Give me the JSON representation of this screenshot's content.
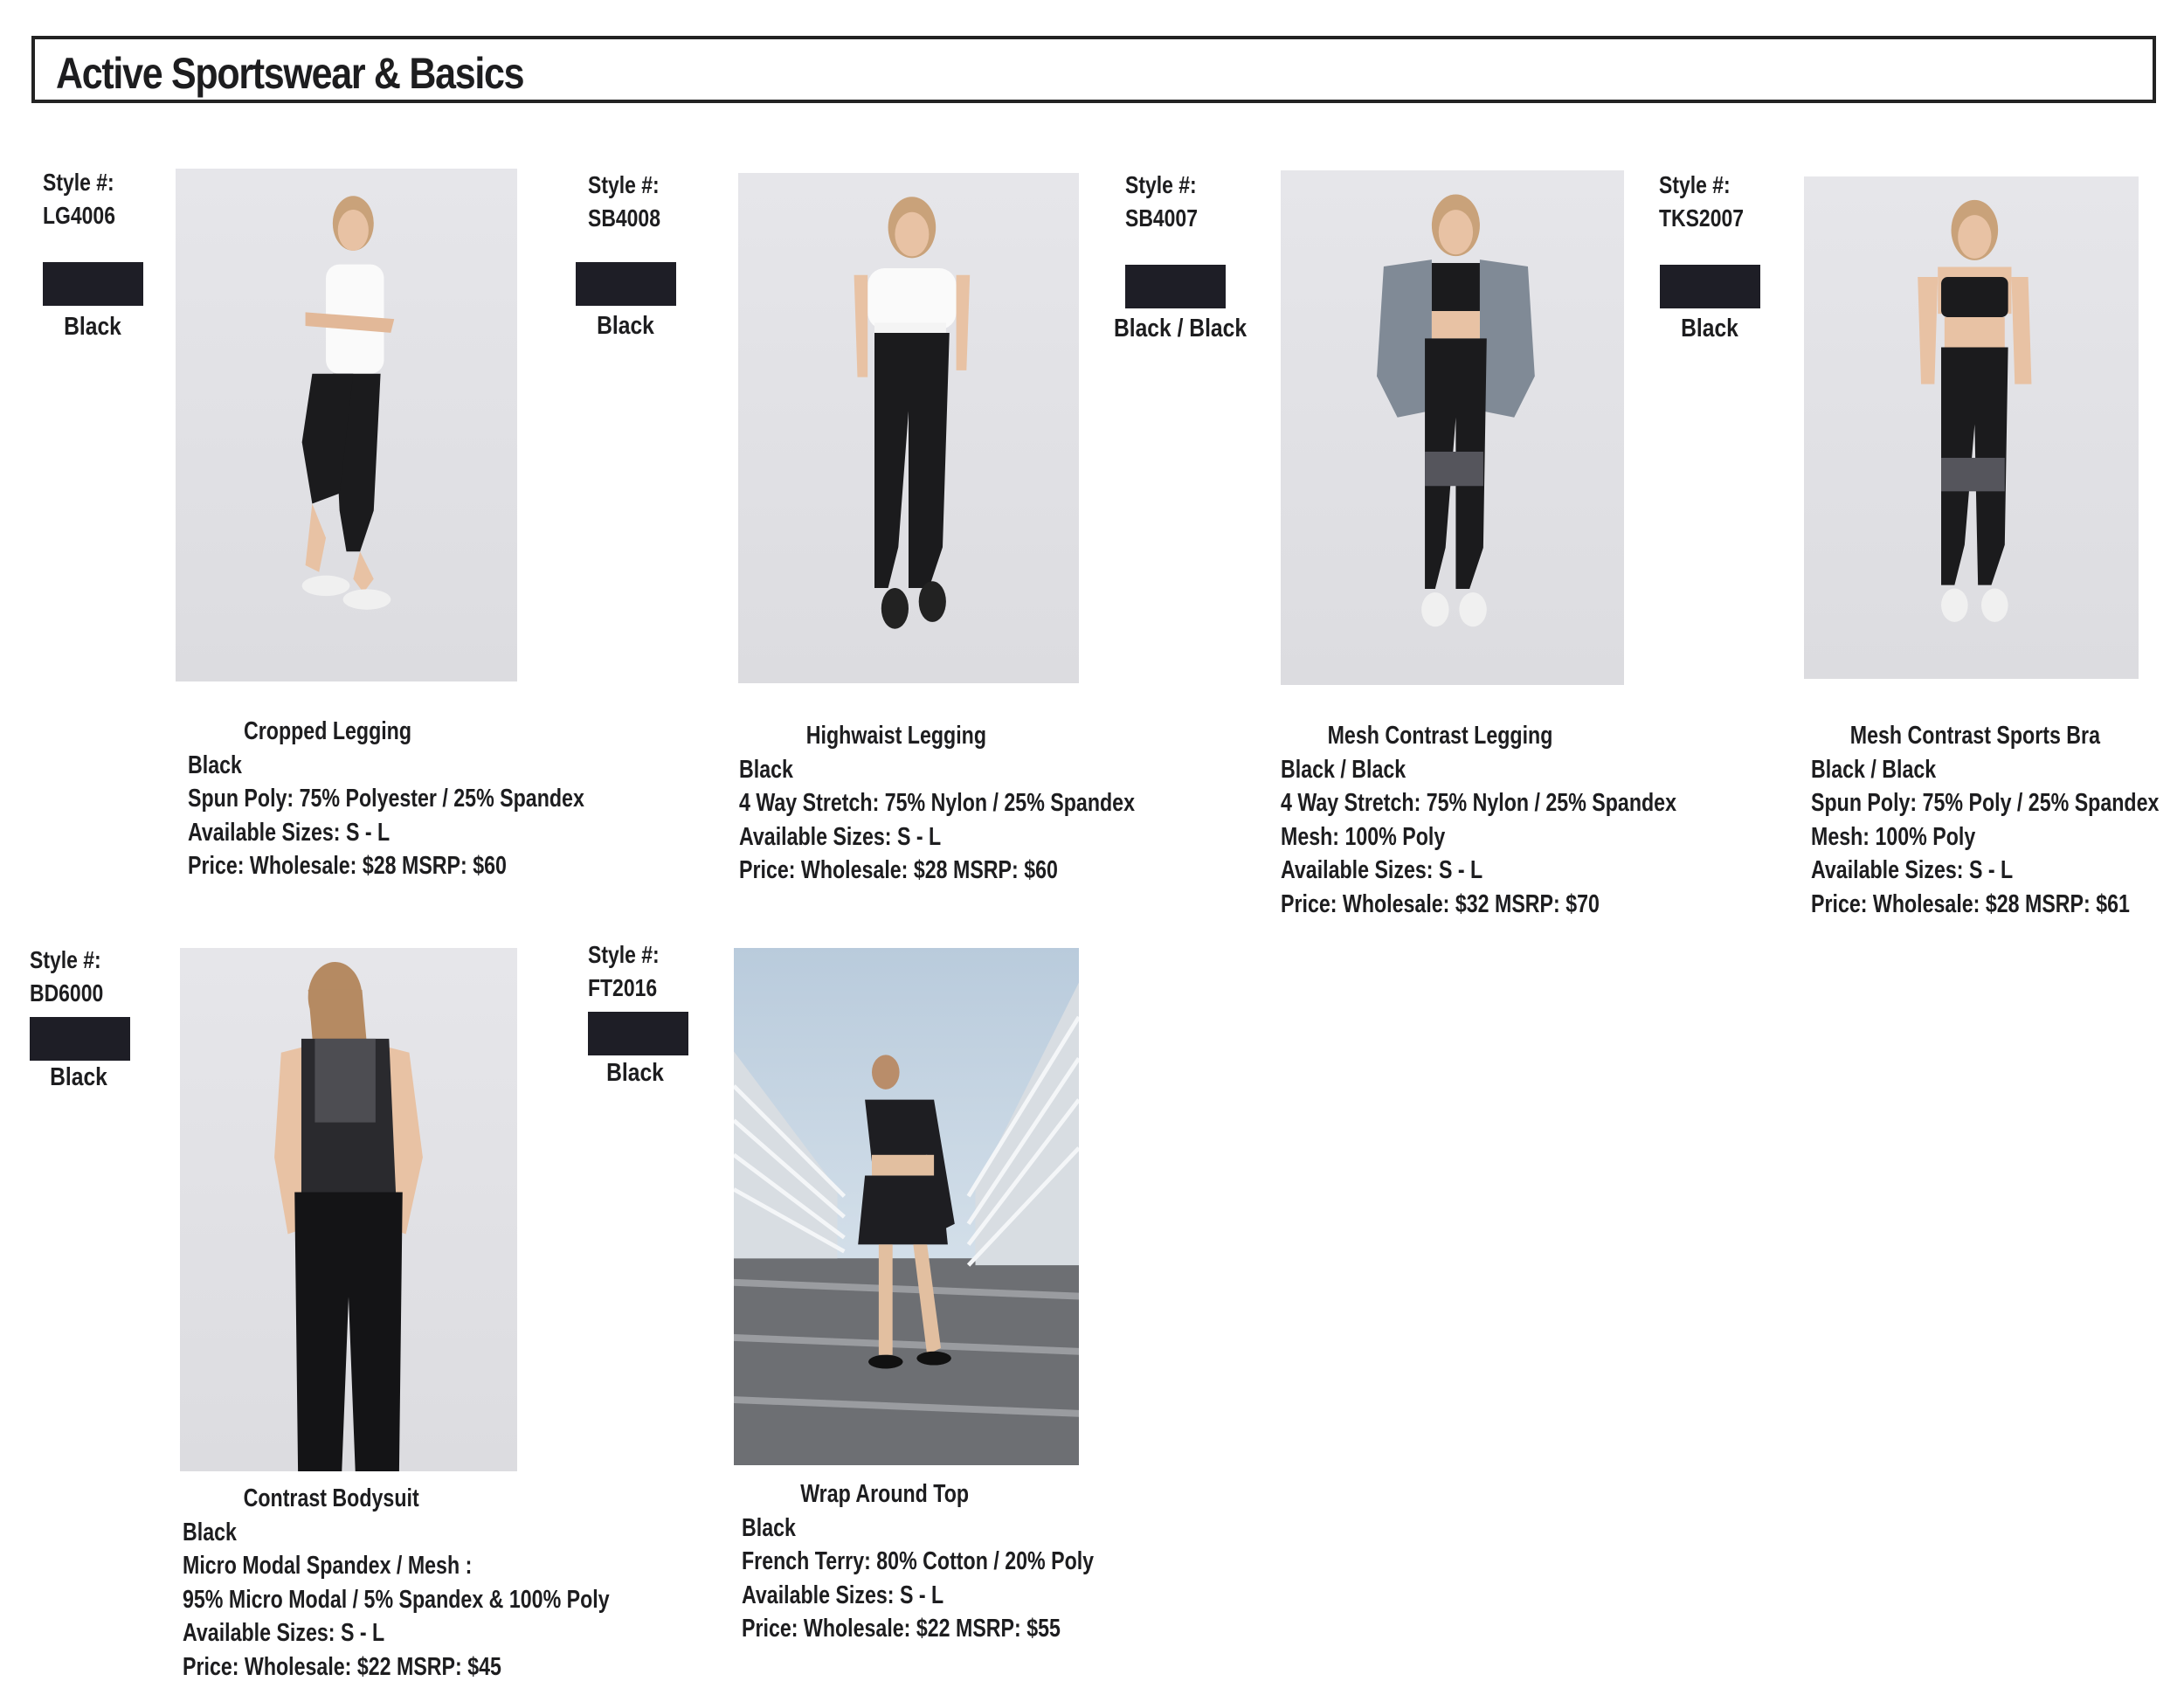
{
  "page_title": "Active Sportswear & Basics",
  "colors": {
    "swatch_black": "#1e1e26",
    "border": "#232323",
    "photo_bg": "#e4e4e8"
  },
  "style_label": "Style #:",
  "products": [
    {
      "style": "LG4006",
      "swatch_color": "Black",
      "name": "Cropped Legging",
      "color": "Black",
      "fabric": "Spun Poly: 75% Polyester / 25% Spandex",
      "sizes": "Available Sizes: S - L",
      "price": "Price: Wholesale: $28  MSRP: $60"
    },
    {
      "style": "SB4008",
      "swatch_color": "Black",
      "name": "Highwaist Legging",
      "color": "Black",
      "fabric": "4 Way Stretch: 75% Nylon / 25% Spandex",
      "sizes": "Available Sizes: S - L",
      "price": "Price: Wholesale: $28  MSRP: $60"
    },
    {
      "style": "SB4007",
      "swatch_color": "Black / Black",
      "name": "Mesh Contrast Legging",
      "color": "Black / Black",
      "fabric": "4 Way Stretch: 75% Nylon / 25% Spandex",
      "fabric2": "Mesh: 100% Poly",
      "sizes": "Available Sizes: S - L",
      "price": "Price: Wholesale: $32  MSRP: $70"
    },
    {
      "style": "TKS2007",
      "swatch_color": "Black",
      "name": "Mesh Contrast Sports Bra",
      "color": "Black / Black",
      "fabric": "Spun Poly: 75% Poly / 25% Spandex",
      "fabric2": "Mesh: 100% Poly",
      "sizes": "Available Sizes: S - L",
      "price": "Price: Wholesale: $28 MSRP: $61"
    },
    {
      "style": "BD6000",
      "swatch_color": "Black",
      "name": "Contrast Bodysuit",
      "color": "Black",
      "fabric": "Micro Modal Spandex / Mesh :",
      "fabric2": "95% Micro Modal / 5% Spandex & 100% Poly",
      "sizes": "Available Sizes: S - L",
      "price": "Price: Wholesale: $22  MSRP: $45"
    },
    {
      "style": "FT2016",
      "swatch_color": "Black",
      "name": "Wrap Around Top",
      "color": "Black",
      "fabric": "French Terry: 80% Cotton / 20% Poly",
      "sizes": "Available Sizes: S - L",
      "price": "Price: Wholesale: $22  MSRP: $55"
    }
  ]
}
